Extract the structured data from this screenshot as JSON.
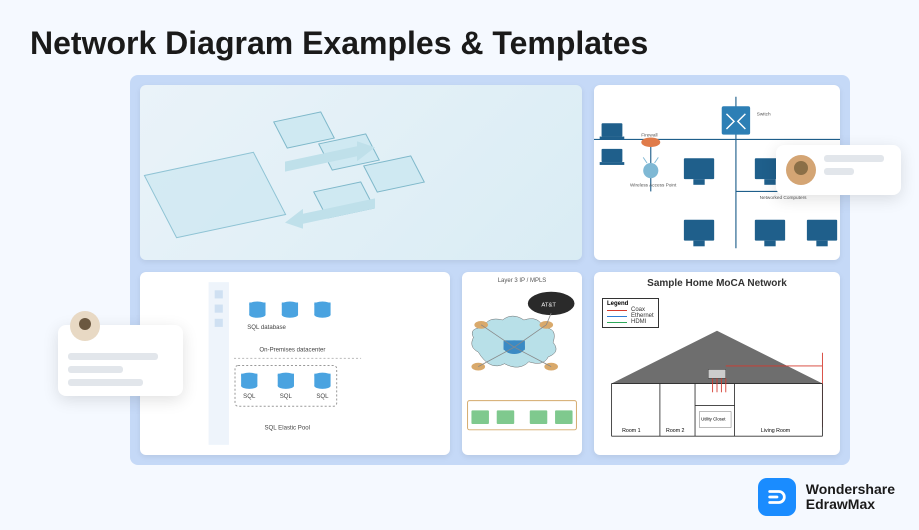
{
  "title": "Network Diagram Examples & Templates",
  "brand": {
    "line1": "Wondershare",
    "line2": "EdrawMax"
  },
  "card2": {
    "labels": {
      "firewall": "Firewall",
      "wap": "Wireless Access Point",
      "nc": "Networked Computers",
      "switch": "Switch"
    }
  },
  "card3": {
    "labels": {
      "sqldb": "SQL database",
      "onprem": "On-Premises datacenter",
      "pool": "SQL Elastic Pool",
      "sql": "SQL"
    }
  },
  "card4": {
    "title": "Layer 3 IP / MPLS",
    "att": "AT&T"
  },
  "card5": {
    "title": "Sample Home MoCA Network",
    "legend": {
      "head": "Legend",
      "coax": "Coax",
      "eth": "Ethernet",
      "hdmi": "HDMI"
    },
    "rooms": {
      "r1": "Room 1",
      "r2": "Room 2",
      "util": "Utility Closet",
      "lr": "Living Room"
    }
  }
}
